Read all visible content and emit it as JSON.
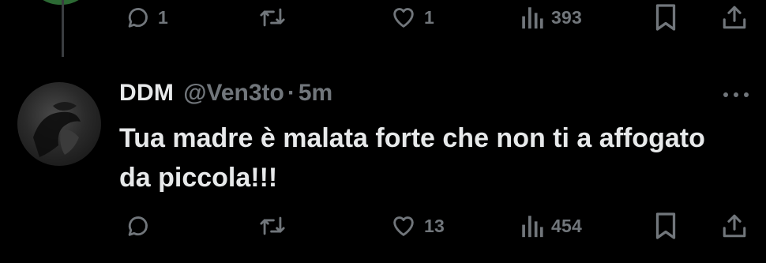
{
  "previous_tweet": {
    "actions": {
      "reply_count": "1",
      "retweet_count": "",
      "like_count": "1",
      "view_count": "393"
    }
  },
  "reply_tweet": {
    "display_name": "DDM",
    "handle": "@Ven3to",
    "separator": "·",
    "time": "5m",
    "text": "Tua madre è malata forte che non ti a affogato da piccola!!!",
    "actions": {
      "reply_count": "",
      "retweet_count": "",
      "like_count": "13",
      "view_count": "454"
    }
  },
  "icons": {
    "reply": "reply-icon",
    "retweet": "retweet-icon",
    "like": "heart-icon",
    "views": "views-icon",
    "bookmark": "bookmark-icon",
    "share": "share-icon",
    "more": "more-icon"
  },
  "colors": {
    "background": "#000000",
    "primary_text": "#e7e9ea",
    "secondary_text": "#71767b",
    "thread_line": "#3a3d40"
  }
}
